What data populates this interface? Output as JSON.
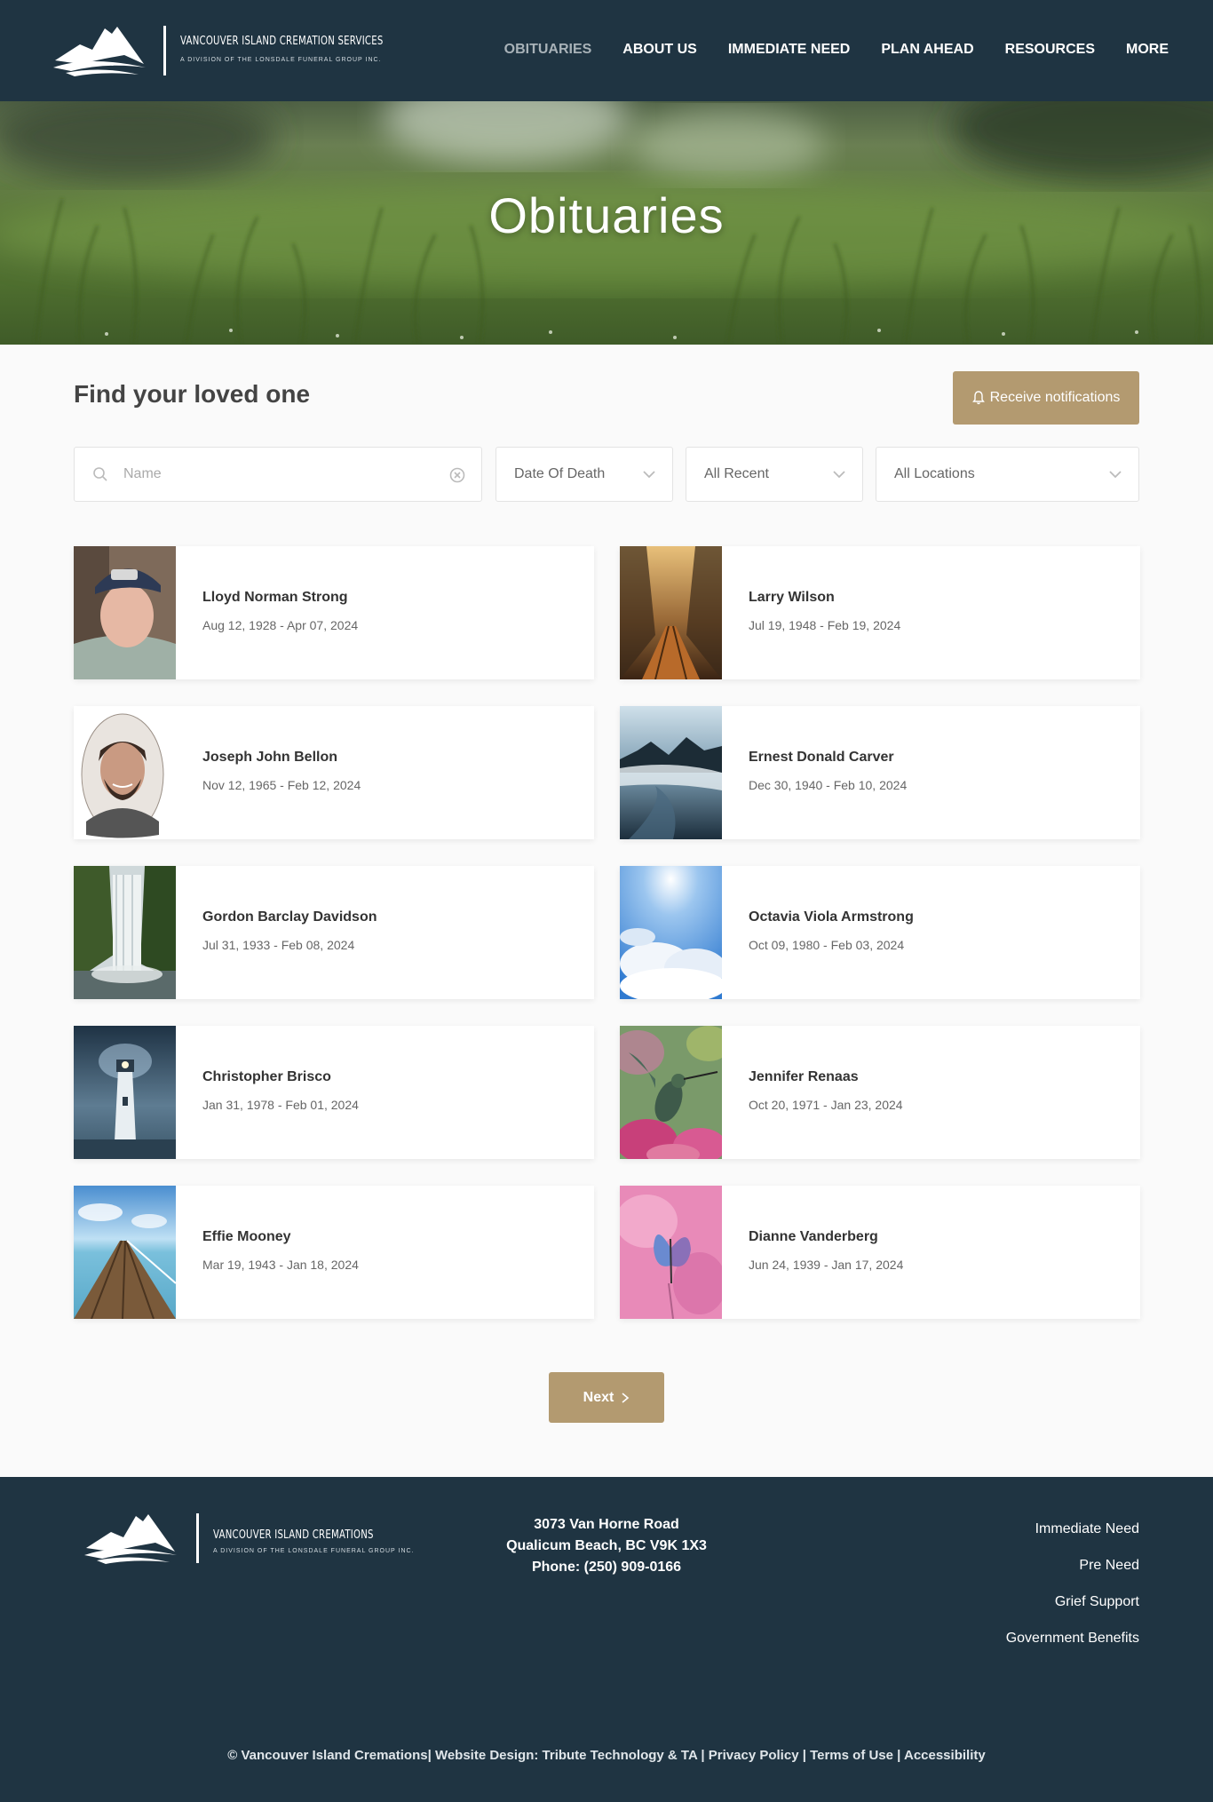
{
  "header": {
    "logo_name": "VANCOUVER ISLAND CREMATION SERVICES",
    "logo_sub": "A DIVISION OF THE LONSDALE FUNERAL GROUP INC.",
    "nav": [
      "OBITUARIES",
      "ABOUT US",
      "IMMEDIATE NEED",
      "PLAN AHEAD",
      "RESOURCES",
      "MORE"
    ]
  },
  "hero": {
    "title": "Obituaries"
  },
  "search": {
    "title": "Find your loved one",
    "notify_label": "Receive notifications",
    "name_placeholder": "Name",
    "date_filter": "Date Of Death",
    "recent_filter": "All Recent",
    "location_filter": "All Locations"
  },
  "obituaries": [
    {
      "name": "Lloyd Norman Strong",
      "dates": "Aug 12, 1928 - Apr 07, 2024",
      "photo": "man-portrait"
    },
    {
      "name": "Larry Wilson",
      "dates": "Jul 19, 1948 - Feb 19, 2024",
      "photo": "railway-forest"
    },
    {
      "name": "Joseph John Bellon",
      "dates": "Nov 12, 1965 - Feb 12, 2024",
      "photo": "man-oval-portrait"
    },
    {
      "name": "Ernest Donald Carver",
      "dates": "Dec 30, 1940 - Feb 10, 2024",
      "photo": "coastal-beach"
    },
    {
      "name": "Gordon Barclay Davidson",
      "dates": "Jul 31, 1933 - Feb 08, 2024",
      "photo": "waterfall"
    },
    {
      "name": "Octavia Viola Armstrong",
      "dates": "Oct 09, 1980 - Feb 03, 2024",
      "photo": "sky-clouds"
    },
    {
      "name": "Christopher Brisco",
      "dates": "Jan 31, 1978 - Feb 01, 2024",
      "photo": "lighthouse"
    },
    {
      "name": "Jennifer Renaas",
      "dates": "Oct 20, 1971 - Jan 23, 2024",
      "photo": "hummingbird"
    },
    {
      "name": "Effie Mooney",
      "dates": "Mar 19, 1943 - Jan 18, 2024",
      "photo": "pier"
    },
    {
      "name": "Dianne Vanderberg",
      "dates": "Jun 24, 1939 - Jan 17, 2024",
      "photo": "butterfly"
    }
  ],
  "pagination": {
    "next_label": "Next"
  },
  "footer": {
    "logo_name": "VANCOUVER ISLAND CREMATIONS",
    "logo_sub": "A DIVISION OF THE LONSDALE FUNERAL GROUP INC.",
    "address_line1": "3073 Van Horne Road",
    "address_line2": "Qualicum Beach, BC V9K 1X3",
    "phone": "Phone: (250) 909-0166",
    "links": [
      "Immediate Need",
      "Pre Need",
      "Grief Support",
      "Government Benefits"
    ],
    "copyright": "© Vancouver Island Cremations| Website Design: Tribute Technology & TA",
    "privacy": "Privacy Policy",
    "terms": "Terms of Use",
    "accessibility": "Accessibility"
  }
}
